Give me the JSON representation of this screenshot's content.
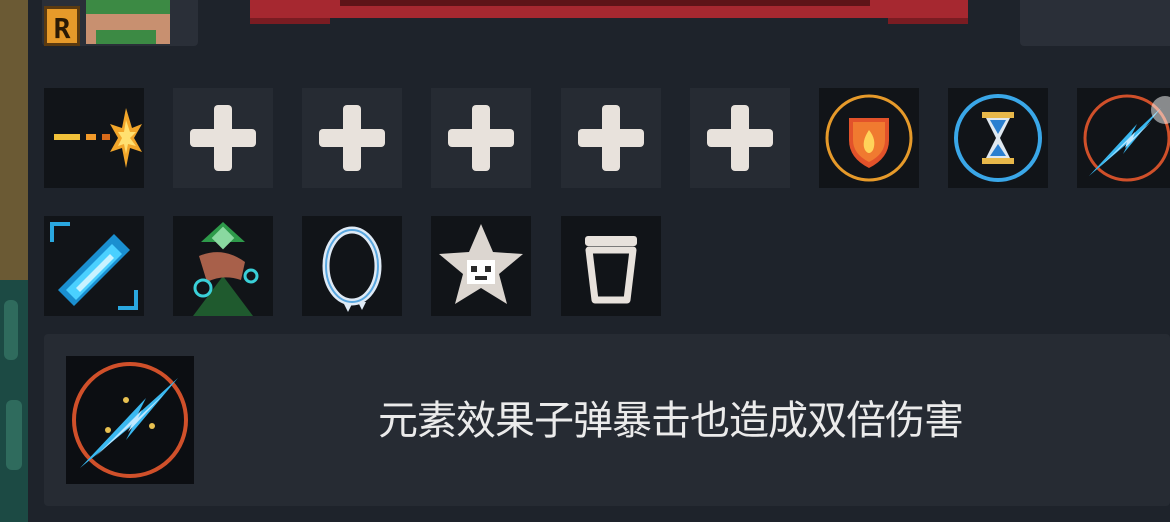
{
  "player": {
    "rank_letter": "R",
    "avatar_label": "hero-portrait"
  },
  "skills": {
    "row1": [
      {
        "name": "bullet-spark",
        "icon": "bullet-spark-icon"
      },
      {
        "name": "empty",
        "icon": "plus-icon"
      },
      {
        "name": "empty",
        "icon": "plus-icon"
      },
      {
        "name": "empty",
        "icon": "plus-icon"
      },
      {
        "name": "empty",
        "icon": "plus-icon"
      },
      {
        "name": "empty",
        "icon": "plus-icon"
      },
      {
        "name": "fire-shield",
        "icon": "fire-shield-icon"
      },
      {
        "name": "hourglass",
        "icon": "hourglass-icon"
      },
      {
        "name": "lightning-crit",
        "icon": "lightning-bolt-icon"
      }
    ],
    "row2": [
      {
        "name": "laser-beam",
        "icon": "laser-beam-icon"
      },
      {
        "name": "wizard-hat",
        "icon": "wizard-hat-icon"
      },
      {
        "name": "ice-ring",
        "icon": "ice-ring-icon"
      },
      {
        "name": "star-badge",
        "icon": "star-face-icon"
      },
      {
        "name": "trash",
        "icon": "trash-can-icon"
      }
    ]
  },
  "selected": {
    "icon": "lightning-bolt-icon",
    "description": "元素效果子弹暴击也造成双倍伤害"
  },
  "colors": {
    "panel": "#1e232b",
    "slot_dark": "#111418",
    "slot_empty": "#262b33",
    "plus": "#e8e2dc",
    "banner": "#a62830",
    "accent_orange": "#e69a2a",
    "accent_blue": "#3aa7e8"
  }
}
